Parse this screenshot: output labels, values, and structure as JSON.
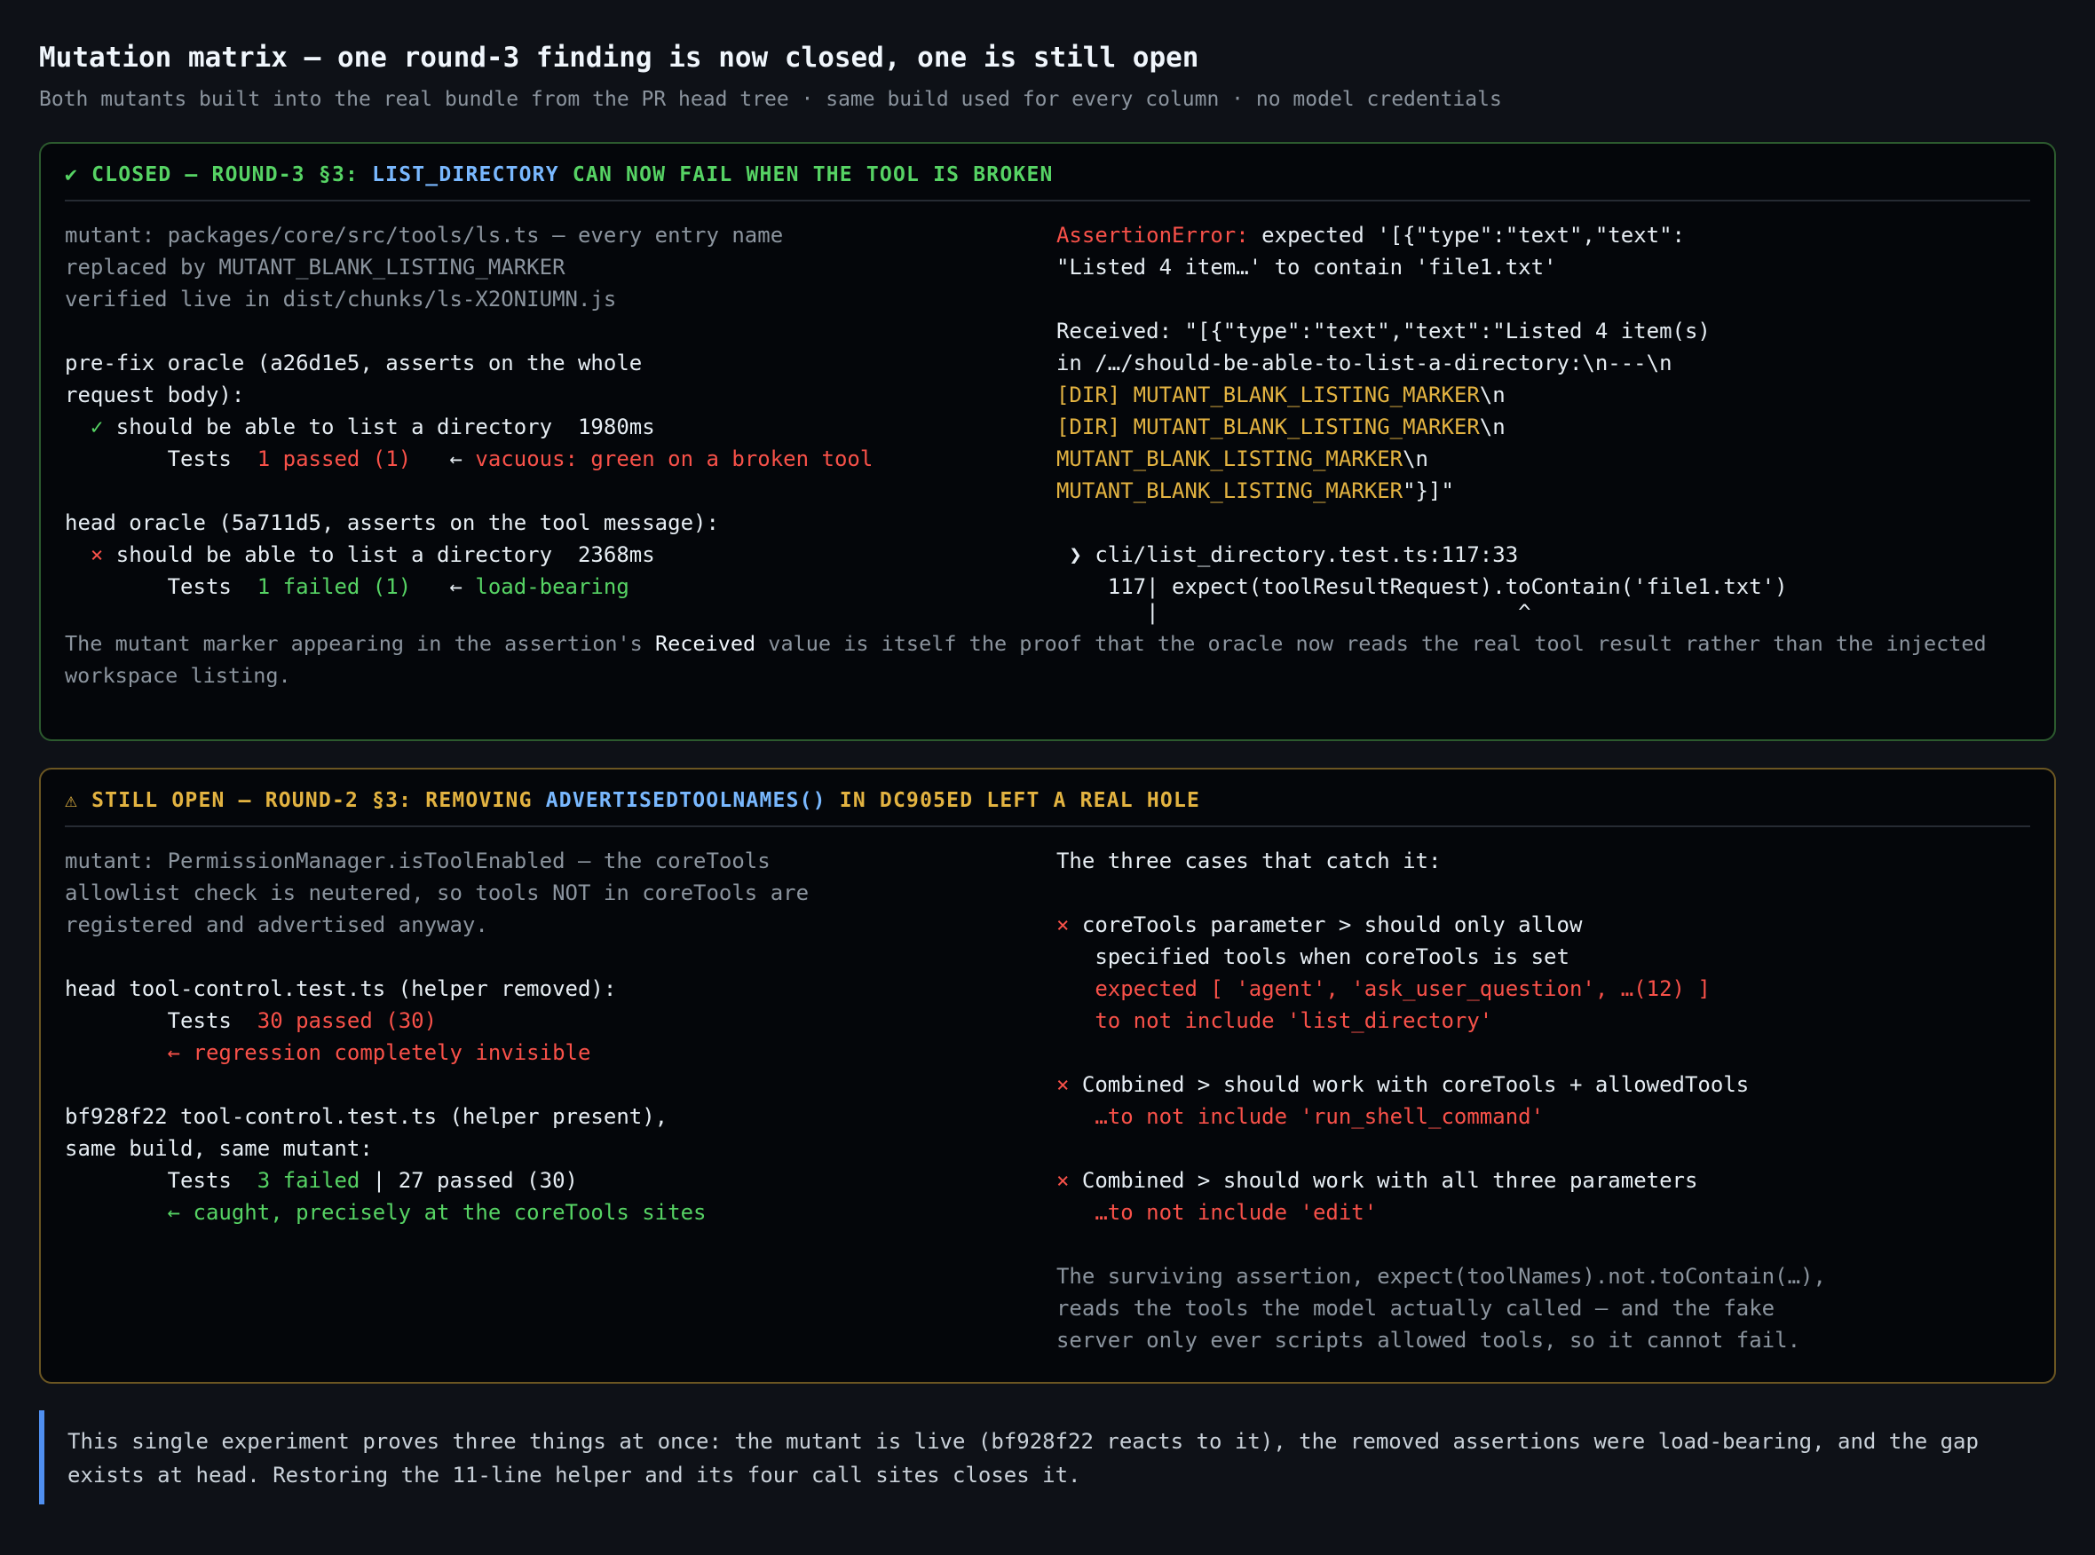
{
  "header": {
    "title": "Mutation matrix — one round-3 finding is now closed, one is still open",
    "subtitle": "Both mutants built into the real bundle from the PR head tree · same build used for every column · no model credentials"
  },
  "closed_panel": {
    "icon": "check-icon",
    "status": "✔ CLOSED — ROUND-3 §3:",
    "highlight": "LIST_DIRECTORY",
    "rest": "CAN NOW FAIL WHEN THE TOOL IS BROKEN",
    "left": {
      "mutant_1": "mutant: packages/core/src/tools/ls.ts — every entry name",
      "mutant_2": "replaced by MUTANT_BLANK_LISTING_MARKER",
      "mutant_3": "verified live in dist/chunks/ls-X2ONIUMN.js",
      "prefix_1": "pre-fix oracle (a26d1e5, asserts on the whole",
      "prefix_2": "request body):",
      "prefix_mark": "  ✓",
      "prefix_test": " should be able to list a directory  1980ms",
      "prefix_tests_label": "        Tests  ",
      "prefix_tests_value": "1 passed (1)",
      "prefix_arrow": "   ← ",
      "prefix_note": "vacuous: green on a broken tool",
      "head_1": "head oracle (5a711d5, asserts on the tool message):",
      "head_mark": "  ×",
      "head_test": " should be able to list a directory  2368ms",
      "head_tests_label": "        Tests  ",
      "head_tests_value": "1 failed (1)",
      "head_arrow": "   ← ",
      "head_note": "load-bearing"
    },
    "right": {
      "err_label": "AssertionError:",
      "err_text": " expected '[{\"type\":\"text\",\"text\":",
      "err_2": "\"Listed 4 item…' to contain 'file1.txt'",
      "recv_1": "Received: \"[{\"type\":\"text\",\"text\":\"Listed 4 item(s)",
      "recv_2": "in /…/should-be-able-to-list-a-directory:\\n---\\n",
      "recv_3a": "[DIR] MUTANT_BLANK_LISTING_MARKER",
      "recv_3b": "\\n",
      "recv_4a": "[DIR] MUTANT_BLANK_LISTING_MARKER",
      "recv_4b": "\\n",
      "recv_5a": "MUTANT_BLANK_LISTING_MARKER",
      "recv_5b": "\\n",
      "recv_6a": "MUTANT_BLANK_LISTING_MARKER",
      "recv_6b": "\"}]\"",
      "loc": " ❯ cli/list_directory.test.ts:117:33",
      "line": "    117| expect(toolResultRequest).toContain('file1.txt')",
      "caret": "       |                            ^"
    },
    "foot_1": "The mutant marker appearing in the assertion's ",
    "foot_bold": "Received",
    "foot_2": " value is itself the proof that the oracle now reads the real tool result rather than the injected",
    "foot_3": "workspace listing."
  },
  "open_panel": {
    "icon": "warning-icon",
    "status": "⚠ STILL OPEN — ROUND-2 §3: REMOVING",
    "highlight": "ADVERTISEDTOOLNAMES()",
    "rest": "IN DC905ED LEFT A REAL HOLE",
    "left": {
      "mutant_1": "mutant: PermissionManager.isToolEnabled — the coreTools",
      "mutant_2": "allowlist check is neutered, so tools NOT in coreTools are",
      "mutant_3": "registered and advertised anyway.",
      "head_1": "head tool-control.test.ts (helper removed):",
      "head_tests_label": "        Tests  ",
      "head_tests_value": "30 passed (30)",
      "head_note": "        ← regression completely invisible",
      "bf_1": "bf928f22 tool-control.test.ts (helper present),",
      "bf_2": "same build, same mutant:",
      "bf_tests_label": "        Tests  ",
      "bf_tests_failed": "3 failed",
      "bf_tests_rest": " | 27 passed (30)",
      "bf_note": "        ← caught, precisely at the coreTools sites"
    },
    "right": {
      "heading": "The three cases that catch it:",
      "case1_mark": "×",
      "case1_1": " coreTools parameter > should only allow",
      "case1_2": "   specified tools when coreTools is set",
      "case1_3": "   expected [ 'agent', 'ask_user_question', …(12) ]",
      "case1_4": "   to not include 'list_directory'",
      "case2_mark": "×",
      "case2_1": " Combined > should work with coreTools + allowedTools",
      "case2_2": "   …to not include 'run_shell_command'",
      "case3_mark": "×",
      "case3_1": " Combined > should work with all three parameters",
      "case3_2": "   …to not include 'edit'",
      "note_1": "The surviving assertion, expect(toolNames).not.toContain(…),",
      "note_2": "reads the tools the model actually called — and the fake",
      "note_3": "server only ever scripts allowed tools, so it cannot fail."
    }
  },
  "callout": {
    "line_1": "This single experiment proves three things at once: the mutant is live (bf928f22 reacts to it), the removed assertions were load-bearing, and the gap",
    "line_2": "exists at head. Restoring the 11-line helper and its four call sites closes it."
  }
}
